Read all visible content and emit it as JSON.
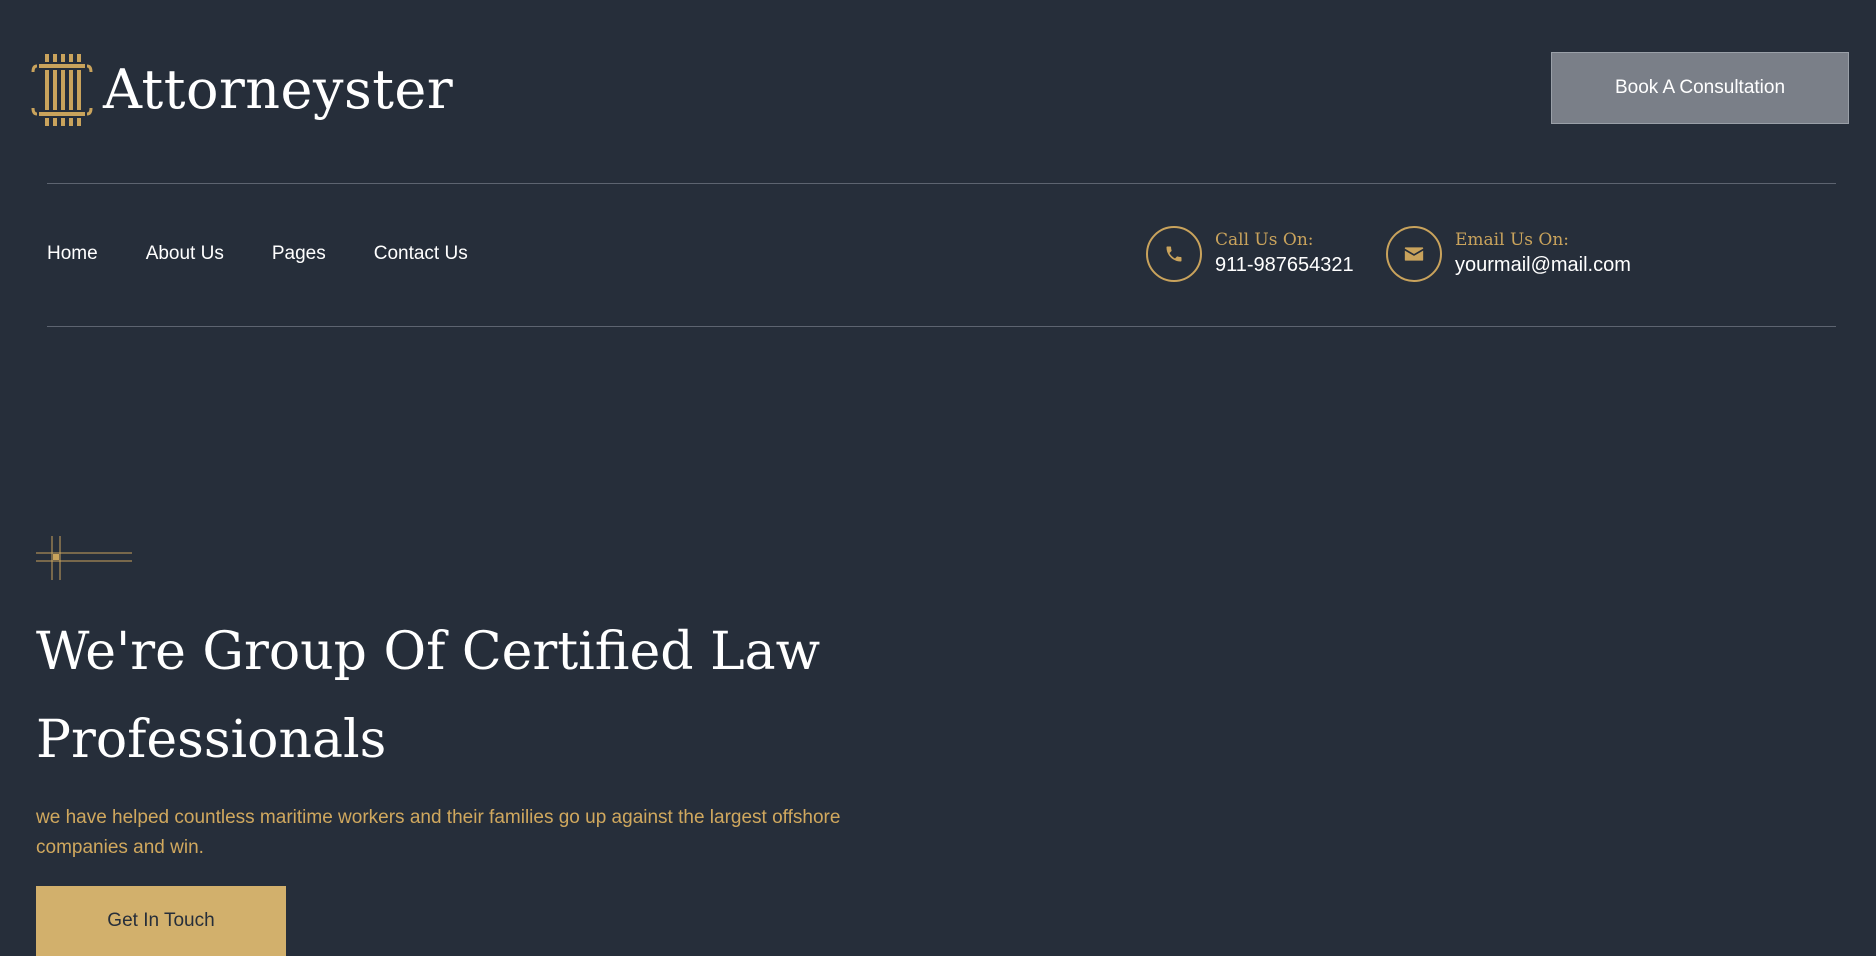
{
  "brand": {
    "name": "Attorneyster",
    "logo_icon": "pillar-icon",
    "accent_color": "#c9a35c",
    "background_color": "#262e3a"
  },
  "header": {
    "cta_label": "Book A Consultation"
  },
  "nav": {
    "items": [
      {
        "label": "Home"
      },
      {
        "label": "About Us"
      },
      {
        "label": "Pages"
      },
      {
        "label": "Contact Us"
      }
    ]
  },
  "contact": {
    "phone": {
      "icon": "phone-icon",
      "label": "Call Us On:",
      "value": "911-987654321"
    },
    "email": {
      "icon": "envelope-icon",
      "label": "Email Us On:",
      "value": "yourmail@mail.com"
    }
  },
  "hero": {
    "ornament_icon": "crosshair-ornament-icon",
    "title": "We're Group Of Certified Law Professionals",
    "subtitle": "we have helped countless maritime workers and their families go up against the largest offshore companies and win.",
    "cta_label": "Get In Touch"
  }
}
